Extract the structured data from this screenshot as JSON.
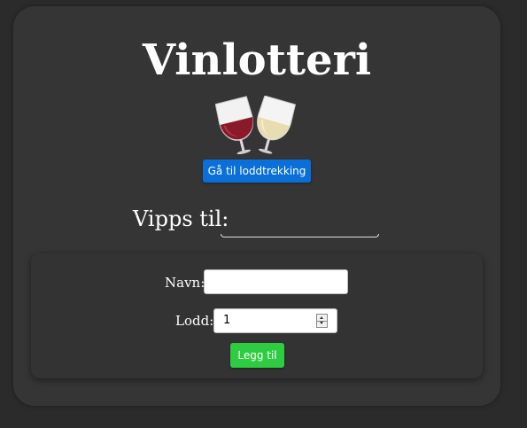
{
  "page": {
    "title": "Vinlotteri",
    "logo_icon": "wine-glasses-cheers-icon"
  },
  "actions": {
    "go_to_draw_label": "Gå til loddtrekking"
  },
  "vipps": {
    "label": "Vipps til:",
    "value": ""
  },
  "form": {
    "name_label": "Navn:",
    "name_value": "",
    "tickets_label": "Lodd:",
    "tickets_value": "1",
    "add_label": "Legg til"
  },
  "colors": {
    "background": "#2b2b2b",
    "card": "#353535",
    "primary_button": "#0a6fd8",
    "add_button": "#2ecc40"
  }
}
